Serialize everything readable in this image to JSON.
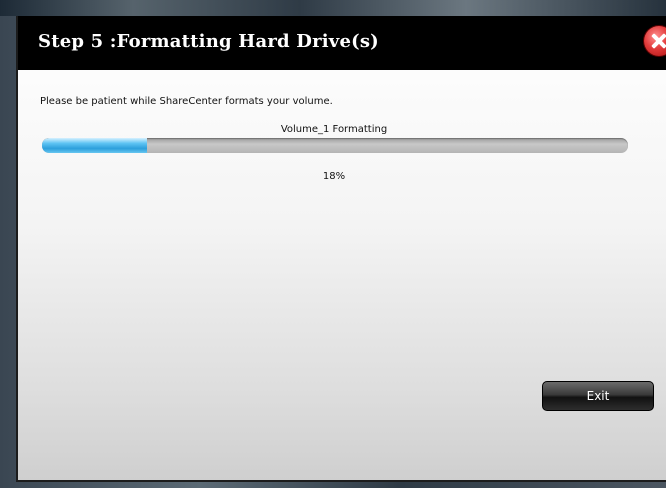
{
  "dialog": {
    "title": "Step 5 :Formatting Hard Drive(s)",
    "message": "Please be patient while ShareCenter formats your volume.",
    "progress": {
      "label": "Volume_1 Formatting",
      "percent_text": "18%",
      "value": 0.18
    },
    "exit_label": "Exit",
    "close_icon": "close-icon"
  },
  "colors": {
    "titlebar": "#000000",
    "progress_fill": "#2c9fdc",
    "close_button": "#e23b3b"
  }
}
